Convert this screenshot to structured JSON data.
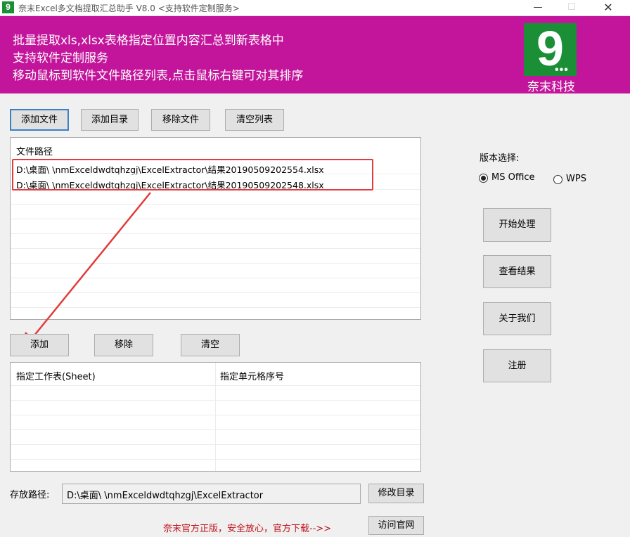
{
  "window": {
    "title": "奈末Excel多文档提取汇总助手 V8.0 <支持软件定制服务>",
    "minimize": "—",
    "maximize": "☐",
    "close": "✕"
  },
  "banner": {
    "lines": [
      "批量提取xls,xlsx表格指定位置内容汇总到新表格中",
      "支持软件定制服务",
      "移动鼠标到软件文件路径列表,点击鼠标右键可对其排序"
    ],
    "logo_caption": "奈末科技",
    "bg_color": "#c3159b",
    "logo_color": "#1a8f35"
  },
  "toolbar": {
    "add_file": "添加文件",
    "add_dir": "添加目录",
    "remove_file": "移除文件",
    "clear_list": "清空列表"
  },
  "file_list": {
    "header": "文件路径",
    "rows": [
      "D:\\桌面\\            \\nmExceldwdtqhzgj\\ExcelExtractor\\结果20190509202554.xlsx",
      "D:\\桌面\\            \\nmExceldwdtqhzgj\\ExcelExtractor\\结果20190509202548.xlsx"
    ]
  },
  "sheet_toolbar": {
    "add": "添加",
    "remove": "移除",
    "clear": "清空"
  },
  "sheet_list": {
    "col_sheet": "指定工作表(Sheet)",
    "col_cell": "指定单元格序号"
  },
  "version": {
    "label": "版本选择:",
    "options": [
      "MS Office",
      "WPS"
    ],
    "selected": "MS Office"
  },
  "actions": {
    "start": "开始处理",
    "view_result": "查看结果",
    "about": "关于我们",
    "register": "注册"
  },
  "output": {
    "label": "存放路径:",
    "path": "D:\\桌面\\            \\nmExceldwdtqhzgj\\ExcelExtractor",
    "change_dir": "修改目录"
  },
  "footer": {
    "promo": "奈末官方正版，安全放心，官方下载-->>",
    "visit_site": "访问官网"
  }
}
